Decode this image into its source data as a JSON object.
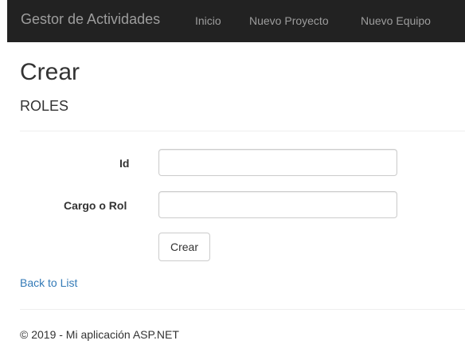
{
  "navbar": {
    "brand": "Gestor de Actividades",
    "links": [
      {
        "label": "Inicio"
      },
      {
        "label": "Nuevo Proyecto"
      },
      {
        "label": "Nuevo Equipo"
      }
    ]
  },
  "page": {
    "title": "Crear",
    "subtitle": "ROLES"
  },
  "form": {
    "fields": [
      {
        "label": "Id",
        "value": "",
        "placeholder": ""
      },
      {
        "label": "Cargo o Rol",
        "value": "",
        "placeholder": ""
      }
    ],
    "submit_label": "Crear"
  },
  "back_link": "Back to List",
  "footer": "© 2019 - Mi aplicación ASP.NET",
  "colors": {
    "navbar_bg": "#222222",
    "navbar_text": "#9d9d9d",
    "link": "#337ab7",
    "text": "#333333"
  }
}
